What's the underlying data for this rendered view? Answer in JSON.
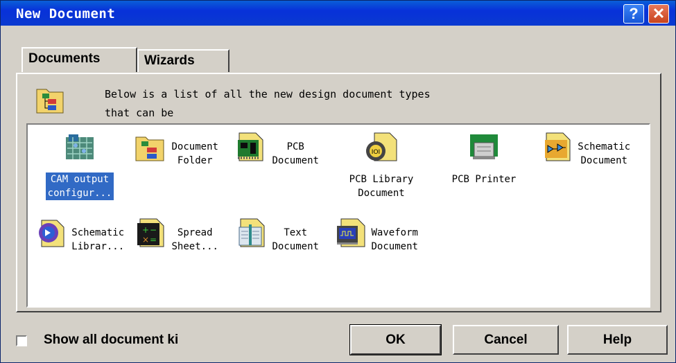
{
  "window": {
    "title": "New Document",
    "help_glyph": "?",
    "close_glyph": "✕"
  },
  "tabs": [
    {
      "label": "Documents"
    },
    {
      "label": "Wizards"
    }
  ],
  "description": {
    "line1": "Below is a list of all the new design document types",
    "line2": "that can be"
  },
  "items": [
    {
      "label": "CAM output\nconfigur...",
      "icon": "cam-output-icon",
      "selected": true
    },
    {
      "label": "Document\nFolder",
      "icon": "document-folder-icon"
    },
    {
      "label": "PCB\nDocument",
      "icon": "pcb-document-icon"
    },
    {
      "label": "PCB Library\nDocument",
      "icon": "pcb-library-icon"
    },
    {
      "label": "PCB Printer",
      "icon": "pcb-printer-icon"
    },
    {
      "label": "Schematic\nDocument",
      "icon": "schematic-document-icon"
    },
    {
      "label": "Schematic\nLibrar...",
      "icon": "schematic-library-icon"
    },
    {
      "label": "Spread\nSheet...",
      "icon": "spreadsheet-icon"
    },
    {
      "label": "Text\nDocument",
      "icon": "text-document-icon"
    },
    {
      "label": "Waveform\nDocument",
      "icon": "waveform-icon"
    }
  ],
  "footer": {
    "show_all_label": "Show all document ki",
    "show_all_checked": false,
    "ok_label": "OK",
    "cancel_label": "Cancel",
    "help_label": "Help"
  },
  "colors": {
    "title_bar": "#0a3ad0",
    "selection": "#316ac5",
    "dialog_bg": "#d4d0c8"
  }
}
